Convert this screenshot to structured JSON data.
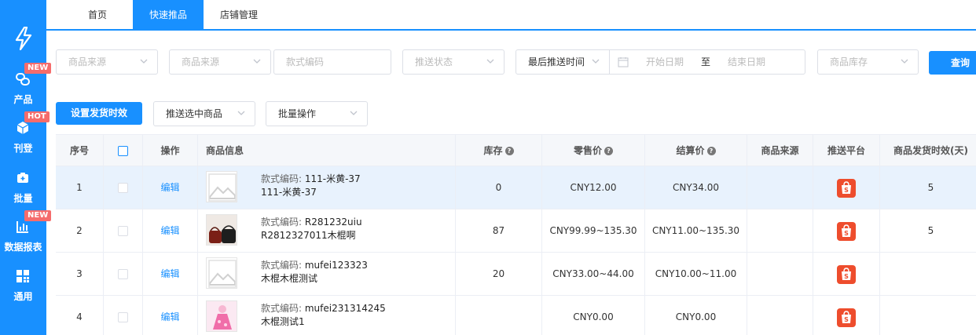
{
  "nav": {
    "items": [
      {
        "label": "产品",
        "badge": "NEW",
        "icon": "link-icon"
      },
      {
        "label": "刊登",
        "badge": "HOT",
        "icon": "cube-icon"
      },
      {
        "label": "批量",
        "badge": "",
        "icon": "batch-icon"
      },
      {
        "label": "数据报表",
        "badge": "NEW",
        "icon": "bar-chart-icon"
      },
      {
        "label": "通用",
        "badge": "",
        "icon": "grid-icon"
      }
    ]
  },
  "tabs": [
    {
      "label": "首页",
      "active": false
    },
    {
      "label": "快速推品",
      "active": true
    },
    {
      "label": "店铺管理",
      "active": false
    }
  ],
  "filters": {
    "source1_placeholder": "商品来源",
    "source2_placeholder": "商品来源",
    "style_code_placeholder": "款式编码",
    "push_status_placeholder": "推送状态",
    "last_push_time": "最后推送时间",
    "start_date_placeholder": "开始日期",
    "date_separator": "至",
    "end_date_placeholder": "结束日期",
    "stock_placeholder": "商品库存",
    "query_label": "查询"
  },
  "actions": {
    "set_ship_time": "设置发货时效",
    "push_selected": "推送选中商品",
    "bulk_ops": "批量操作"
  },
  "table": {
    "headers": {
      "index": "序号",
      "action": "操作",
      "product_info": "商品信息",
      "stock": "库存",
      "retail_price": "零售价",
      "settle_price": "结算价",
      "source": "商品来源",
      "platform": "推送平台",
      "ship_time": "商品发货时效(天)"
    },
    "code_prefix": "款式编码: ",
    "edit_label": "编辑",
    "rows": [
      {
        "index": "1",
        "code": "111-米黄-37",
        "name": "111-米黄-37",
        "stock": "0",
        "retail": "CNY12.00",
        "settle": "CNY34.00",
        "source": "",
        "ship_time": "5",
        "thumb": "placeholder",
        "highlight": true
      },
      {
        "index": "2",
        "code": "R281232uiu",
        "name": "R2812327011木棍啊",
        "stock": "87",
        "retail": "CNY99.99~135.30",
        "settle": "CNY11.00~135.30",
        "source": "",
        "ship_time": "5",
        "thumb": "bags",
        "highlight": false
      },
      {
        "index": "3",
        "code": "mufei123323",
        "name": "木棍木棍测试",
        "stock": "20",
        "retail": "CNY33.00~44.00",
        "settle": "CNY10.00~11.00",
        "source": "",
        "ship_time": "",
        "thumb": "placeholder",
        "highlight": false
      },
      {
        "index": "4",
        "code": "mufei231314245",
        "name": "木棍测试1",
        "stock": "",
        "retail": "CNY0.00",
        "settle": "CNY0.00",
        "source": "",
        "ship_time": "",
        "thumb": "pink",
        "highlight": false
      }
    ]
  },
  "colors": {
    "primary": "#1890ff",
    "badge": "#f56c6c",
    "shopee": "#ee4d2d"
  }
}
